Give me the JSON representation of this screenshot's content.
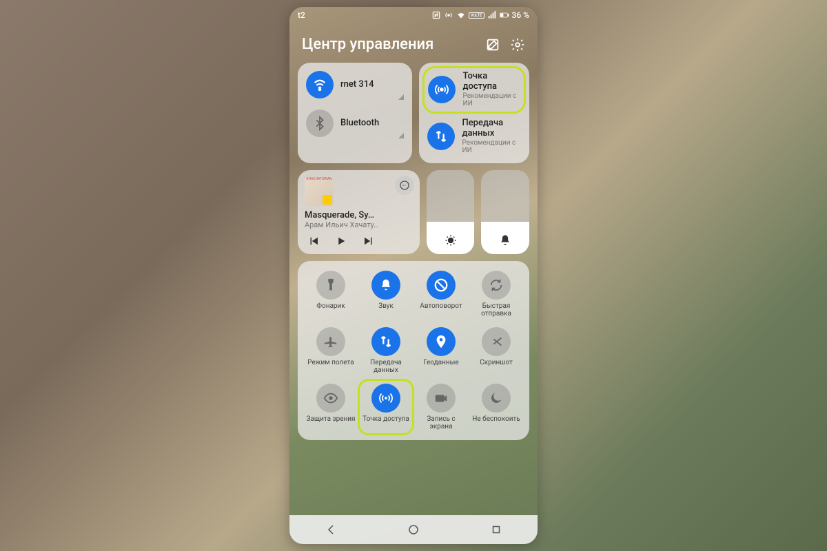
{
  "status": {
    "carrier": "t2",
    "battery": "36 %"
  },
  "header": {
    "title": "Центр управления"
  },
  "wifi": {
    "label": "rnet 314"
  },
  "bluetooth": {
    "label": "Bluetooth"
  },
  "hotspot": {
    "title": "Точка доступа",
    "sub": "Рекомендации с ИИ"
  },
  "data": {
    "title": "Передача данных",
    "sub": "Рекомендации с ИИ"
  },
  "music": {
    "album_tag": "KHACHATURIAN",
    "title": "Masquerade, Sy…",
    "artist": "Арам Ильич Хачату…"
  },
  "grid": [
    {
      "label": "Фонарик",
      "icon": "flashlight",
      "on": false
    },
    {
      "label": "Звук",
      "icon": "bell",
      "on": true
    },
    {
      "label": "Автоповорот",
      "icon": "rotate",
      "on": true
    },
    {
      "label": "Быстрая отправка",
      "icon": "share",
      "on": false
    },
    {
      "label": "Режим полета",
      "icon": "plane",
      "on": false
    },
    {
      "label": "Передача данных",
      "icon": "updown",
      "on": true
    },
    {
      "label": "Геоданные",
      "icon": "pin",
      "on": true
    },
    {
      "label": "Скриншот",
      "icon": "scissors",
      "on": false
    },
    {
      "label": "Защита зрения",
      "icon": "eye",
      "on": false
    },
    {
      "label": "Точка доступа",
      "icon": "hotspot",
      "on": true,
      "hl": true
    },
    {
      "label": "Запись с экрана",
      "icon": "camera",
      "on": false
    },
    {
      "label": "Не беспокоить",
      "icon": "moon",
      "on": false
    }
  ]
}
